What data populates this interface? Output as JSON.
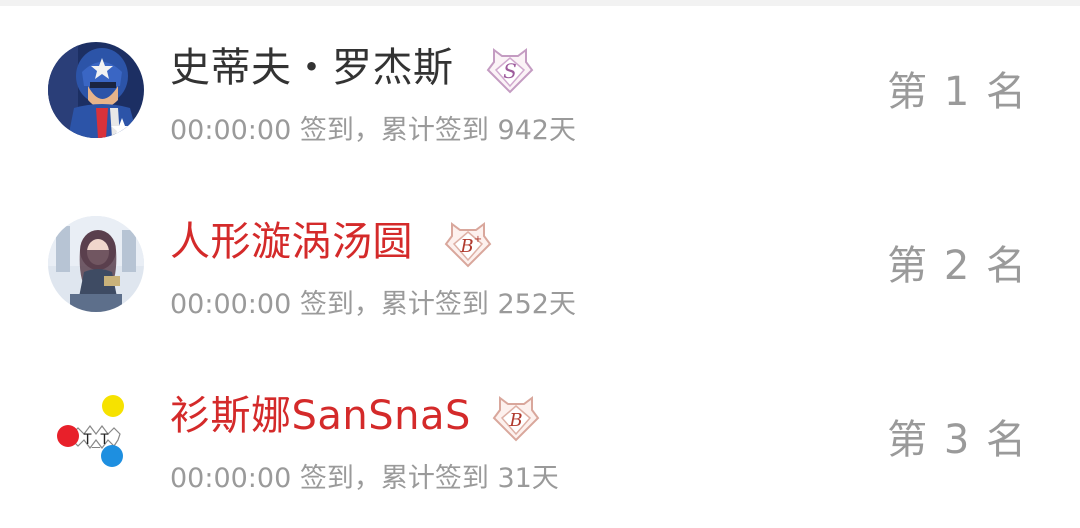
{
  "users": [
    {
      "name": "史蒂夫・罗杰斯",
      "badge_icon": "level-s-badge-icon",
      "checkin_time": "00:00:00",
      "checkin_text": "签到，累计签到 942天",
      "rank_text": "第 1 名",
      "name_color": "#333333"
    },
    {
      "name": "人形漩涡汤圆",
      "badge_icon": "level-b-plus-badge-icon",
      "checkin_time": "00:00:00",
      "checkin_text": "签到，累计签到 252天",
      "rank_text": "第 2 名",
      "name_color": "#d42a2a"
    },
    {
      "name": "衫斯娜SanSnaS",
      "badge_icon": "level-b-badge-icon",
      "checkin_time": "00:00:00",
      "checkin_text": "签到，累计签到 31天",
      "rank_text": "第 3 名",
      "name_color": "#d42a2a"
    }
  ],
  "colors": {
    "vip_name": "#d42a2a",
    "normal_name": "#333333",
    "meta_text": "#9a9a9a",
    "badge_s": "#b56bb0",
    "badge_b": "#c0392b"
  }
}
